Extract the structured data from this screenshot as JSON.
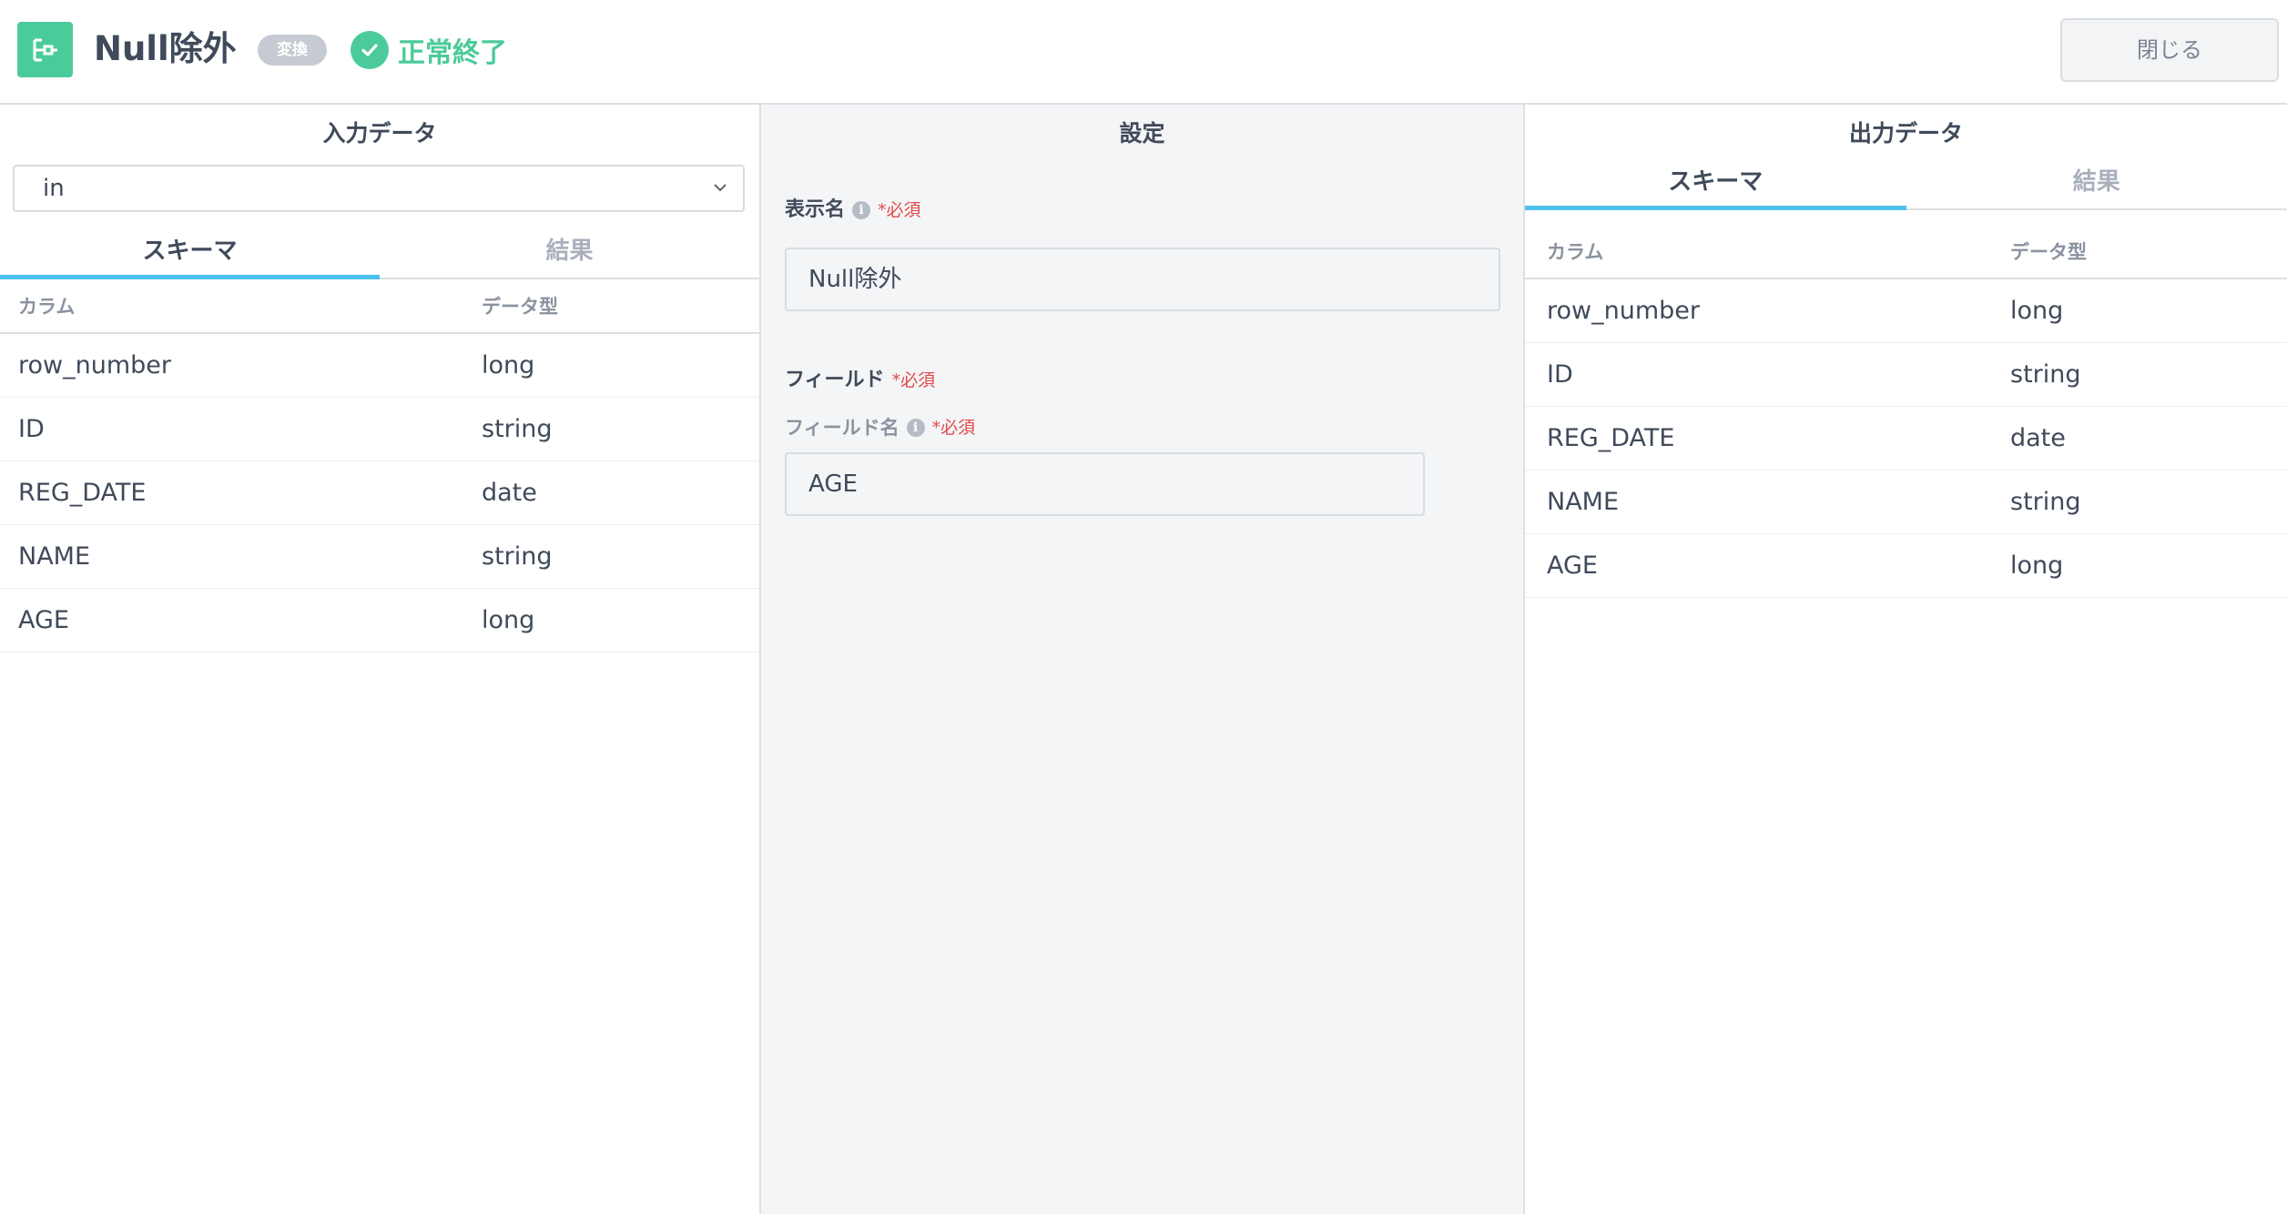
{
  "header": {
    "title": "Null除外",
    "type_badge": "変換",
    "status": "正常終了",
    "close_label": "閉じる",
    "accent_color": "#4ccb9a"
  },
  "input_panel": {
    "title": "入力データ",
    "selected_input": "in",
    "tabs": [
      {
        "label": "スキーマ",
        "active": true
      },
      {
        "label": "結果",
        "active": false
      }
    ],
    "columns": {
      "name": "カラム",
      "type": "データ型"
    },
    "rows": [
      {
        "name": "row_number",
        "type": "long"
      },
      {
        "name": "ID",
        "type": "string"
      },
      {
        "name": "REG_DATE",
        "type": "date"
      },
      {
        "name": "NAME",
        "type": "string"
      },
      {
        "name": "AGE",
        "type": "long"
      }
    ]
  },
  "settings_panel": {
    "title": "設定",
    "display_name": {
      "label": "表示名",
      "required": "*必須",
      "value": "Null除外"
    },
    "field": {
      "label": "フィールド",
      "required": "*必須",
      "field_name_label": "フィールド名",
      "field_name_required": "*必須",
      "field_name_value": "AGE"
    }
  },
  "output_panel": {
    "title": "出力データ",
    "tabs": [
      {
        "label": "スキーマ",
        "active": true
      },
      {
        "label": "結果",
        "active": false
      }
    ],
    "columns": {
      "name": "カラム",
      "type": "データ型"
    },
    "rows": [
      {
        "name": "row_number",
        "type": "long"
      },
      {
        "name": "ID",
        "type": "string"
      },
      {
        "name": "REG_DATE",
        "type": "date"
      },
      {
        "name": "NAME",
        "type": "string"
      },
      {
        "name": "AGE",
        "type": "long"
      }
    ]
  }
}
